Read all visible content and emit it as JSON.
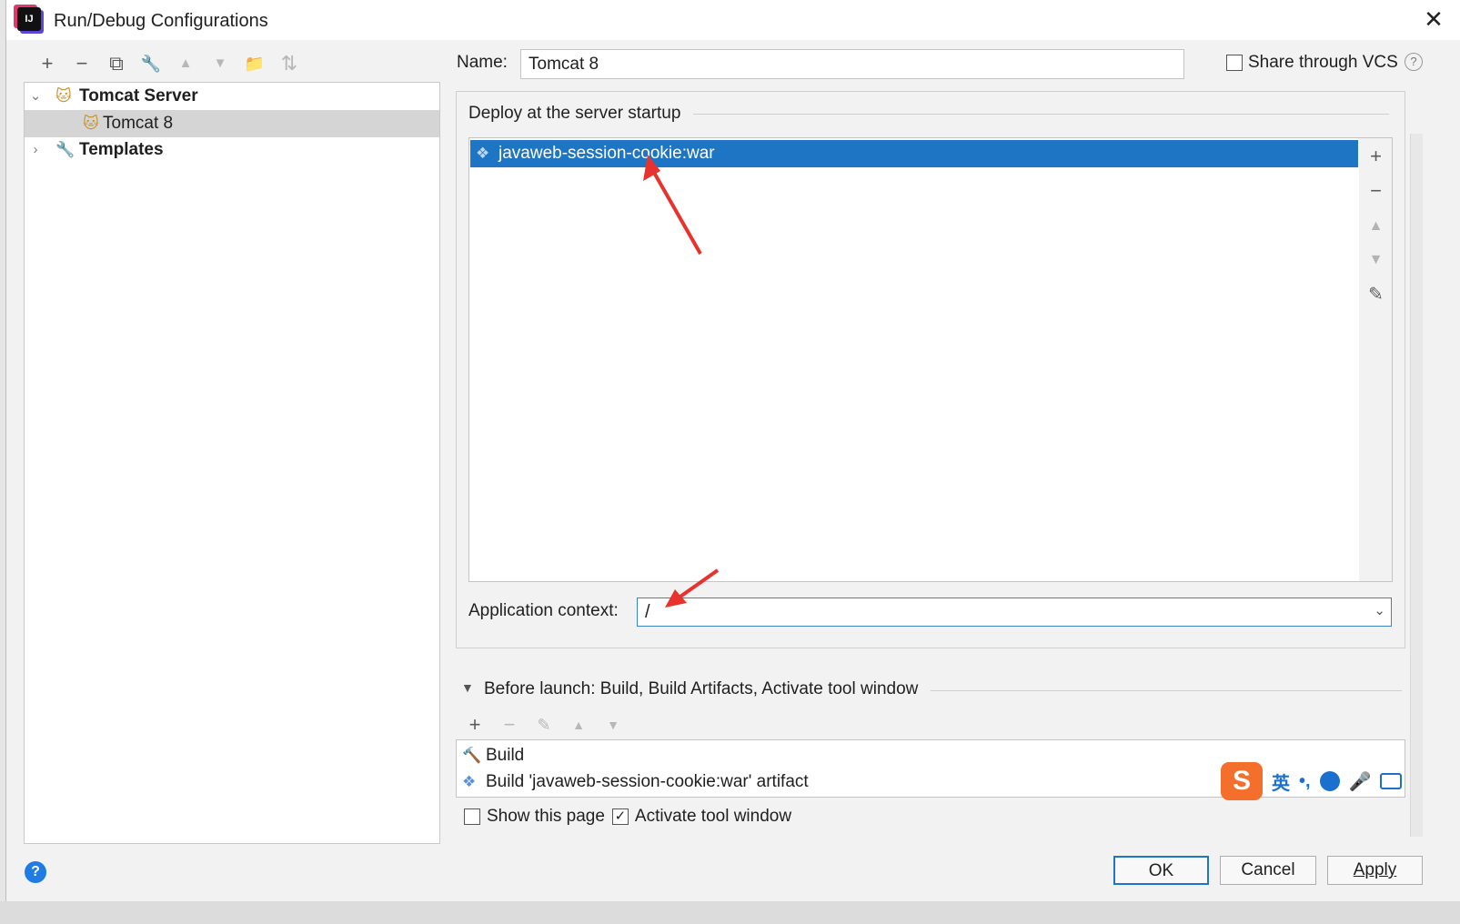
{
  "window": {
    "title": "Run/Debug Configurations",
    "close_icon": "✕"
  },
  "left_toolbar": {
    "buttons": [
      {
        "name": "add-button",
        "glyph": "+",
        "enabled": true
      },
      {
        "name": "remove-button",
        "glyph": "−",
        "enabled": true
      },
      {
        "name": "copy-button",
        "glyph": "⧉",
        "enabled": true
      },
      {
        "name": "edit-defaults-button",
        "glyph": "🔧",
        "enabled": true
      },
      {
        "name": "move-up-button",
        "glyph": "▲",
        "enabled": false
      },
      {
        "name": "move-down-button",
        "glyph": "▼",
        "enabled": false
      },
      {
        "name": "new-folder-button",
        "glyph": "📁",
        "enabled": true
      },
      {
        "name": "sort-button",
        "glyph": "⇅",
        "enabled": false
      }
    ]
  },
  "tree": {
    "items": [
      {
        "label": "Tomcat Server",
        "bold": true,
        "expanded": true,
        "icon": "tomcat-icon"
      },
      {
        "label": "Tomcat 8",
        "bold": false,
        "selected": true,
        "icon": "tomcat-icon"
      },
      {
        "label": "Templates",
        "bold": true,
        "expanded": false,
        "icon": "wrench-icon"
      }
    ]
  },
  "name_field": {
    "label": "Name:",
    "value": "Tomcat 8"
  },
  "share_vcs": {
    "label": "Share through VCS",
    "checked": false
  },
  "deploy": {
    "title": "Deploy at the server startup",
    "items": [
      {
        "label": "javaweb-session-cookie:war",
        "selected": true,
        "icon": "artifact-icon"
      }
    ],
    "side_buttons": [
      "+",
      "−",
      "▲",
      "▼",
      "✎"
    ]
  },
  "app_context": {
    "label": "Application context:",
    "value": "/"
  },
  "before_launch": {
    "title": "Before launch: Build, Build Artifacts, Activate tool window",
    "items": [
      {
        "label": "Build",
        "icon": "hammer-icon"
      },
      {
        "label": "Build 'javaweb-session-cookie:war' artifact",
        "icon": "artifact-icon"
      }
    ]
  },
  "options": {
    "show_page": {
      "label": "Show this page",
      "checked": false
    },
    "activate_tool": {
      "label": "Activate tool window",
      "checked": true
    }
  },
  "buttons": {
    "ok": "OK",
    "cancel": "Cancel",
    "apply": "Apply"
  },
  "ime": {
    "logo": "S",
    "lang": "英",
    "punct": "•,",
    "colors": {
      "logo": "#f36f2b",
      "accent": "#1b6fce"
    }
  },
  "colors": {
    "selection": "#1e75c4",
    "tree_selection": "#d5d5d5",
    "arrow": "#e8322d"
  }
}
